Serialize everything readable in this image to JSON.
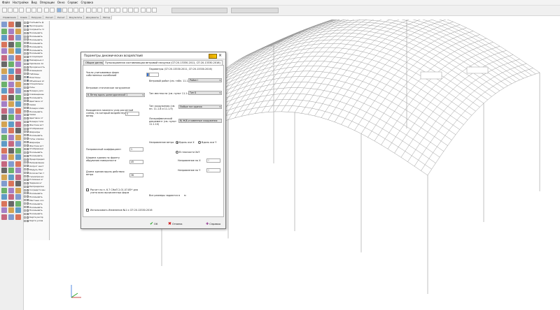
{
  "menu": [
    "Файл",
    "Настройки",
    "Вид",
    "Операции",
    "Окно",
    "Сервис",
    "Справка"
  ],
  "tabstrip": [
    "Управление",
    "Схема",
    "Нагрузки",
    "Расчет",
    "Расчет",
    "Результаты",
    "Документы",
    "Метод"
  ],
  "layers": [
    {
      "label": "Учитывать ф",
      "checked": false
    },
    {
      "label": "Пропорцион",
      "checked": true
    },
    {
      "label": "Сохранять гл",
      "checked": false
    },
    {
      "label": "Показывать",
      "checked": false
    },
    {
      "label": "Показывать",
      "checked": false
    },
    {
      "label": "Показывать",
      "checked": false
    },
    {
      "label": "Показывать",
      "checked": false
    },
    {
      "label": "Показывать",
      "checked": false
    },
    {
      "label": "Показывать",
      "checked": false
    },
    {
      "label": "Показывать",
      "checked": false
    },
    {
      "label": "Ассоциации",
      "checked": false
    },
    {
      "label": "Размерные л",
      "checked": true
    },
    {
      "label": "Удаление ли",
      "checked": false
    },
    {
      "label": "Прозрачность",
      "checked": false
    },
    {
      "label": "Освещение",
      "checked": false
    },
    {
      "label": "Таблицы",
      "checked": false
    },
    {
      "label": "Пластины",
      "checked": true
    },
    {
      "label": "Объемные эл",
      "checked": true
    },
    {
      "label": "Специальны",
      "checked": false
    },
    {
      "label": "Узлы",
      "checked": false
    },
    {
      "label": "Номера узло",
      "checked": false
    },
    {
      "label": "Совмещенны",
      "checked": false
    },
    {
      "label": "Показывать",
      "checked": false
    },
    {
      "label": "Цветовое от",
      "checked": false
    },
    {
      "label": "Связи",
      "checked": false
    },
    {
      "label": "Номера элем",
      "checked": false
    },
    {
      "label": "Показывать",
      "checked": false
    },
    {
      "label": "Связи",
      "checked": false
    },
    {
      "label": "Цветовое от",
      "checked": false
    },
    {
      "label": "Номера типо",
      "checked": false
    },
    {
      "label": "Жесткие вст",
      "checked": false
    },
    {
      "label": "Отображени",
      "checked": false
    },
    {
      "label": "Шарниры",
      "checked": false
    },
    {
      "label": "Показывать",
      "checked": false
    },
    {
      "label": "Типы элемен",
      "checked": false
    },
    {
      "label": "Шарниры",
      "checked": false
    },
    {
      "label": "Жесткие вст",
      "checked": false
    },
    {
      "label": "Отображени",
      "checked": false
    },
    {
      "label": "Показывать",
      "checked": false
    },
    {
      "label": "Показывать",
      "checked": false
    },
    {
      "label": "Предопредел",
      "checked": false
    },
    {
      "label": "Направление",
      "checked": false
    },
    {
      "label": "Оопрот жест",
      "checked": false
    },
    {
      "label": "Модуль Юнг",
      "checked": false
    },
    {
      "label": "Количество т",
      "checked": false
    },
    {
      "label": "Геометричес",
      "checked": false
    },
    {
      "label": "Условные нг",
      "checked": false
    },
    {
      "label": "Задание нг",
      "checked": false
    },
    {
      "label": "Распределен",
      "checked": false
    },
    {
      "label": "Сосредоточен",
      "checked": false
    },
    {
      "label": "Показывать",
      "checked": false
    },
    {
      "label": "Показывать",
      "checked": false
    },
    {
      "label": "Местные оси",
      "checked": false
    },
    {
      "label": "Показывать",
      "checked": false
    },
    {
      "label": "Показывать",
      "checked": false
    },
    {
      "label": "Показывать",
      "checked": false
    },
    {
      "label": "Показывать",
      "checked": false
    },
    {
      "label": "Карта распр",
      "checked": false
    },
    {
      "label": "Карта узлов",
      "checked": false
    }
  ],
  "dialog": {
    "title": "Параметры динамических воздействий",
    "tabs": [
      "Общие данные",
      "Пульсационная составляющая ветровой нагрузки (СП 20.13330.2011, СП 20.13330.2016)"
    ],
    "params_header": "Параметры (СП 20.13330.2011, СП 20.13330.2016)",
    "modes_label": "Число учитываемых форм собственных колебаний",
    "static_load_label": "Ветровое статическое загружение",
    "static_load_value": "6. Ветер вдоль цилиндрической 1",
    "node_label": "Координата нижнего узла расчетной схемы, на который воздействует ветер",
    "node_value": "0",
    "correction_label": "Поправочный коэффициент",
    "correction_value": "1",
    "width_label": "Ширина здания по фронту обдувания поверхности",
    "width_value": "45",
    "length_label": "Длина здания вдоль действия ветра",
    "length_value": "36",
    "wind_region_label": "Ветровой район (см. табл. 11.1)",
    "wind_region_value": "Район I",
    "terrain_label": "Тип местности (см. пункт 11.1.6)",
    "terrain_value": "Тип Б",
    "structure_label": "Тип сооружения (см. пп. 11.1.8 и 11.1.9)",
    "structure_value": "Любые тип здания",
    "decrement_label": "Логарифмический декремент (см. пункт 11.1.10)",
    "decrement_value": "б) Ж/Б и каменные сооружения",
    "direction_label": "Направление ветра",
    "dir_x": "Вдоль оси X",
    "dir_y": "Вдоль оси Y",
    "dir_plane": "В плоскости XoY",
    "dir_angle_x": "Направление по X",
    "dir_angle_y": "Направление по Y",
    "dir_angle_value": "0",
    "units_label": "Все размеры задаются в",
    "units_value": "м",
    "checkbox1": "Расчет по п. 6.7 СНиП 2.01.07-85* для учета всех вычисленных форм",
    "checkbox2": "Использовать Изменение №1 к СП 20.13330.2016",
    "ok": "ОК",
    "cancel": "Отмена",
    "help": "Справка"
  }
}
